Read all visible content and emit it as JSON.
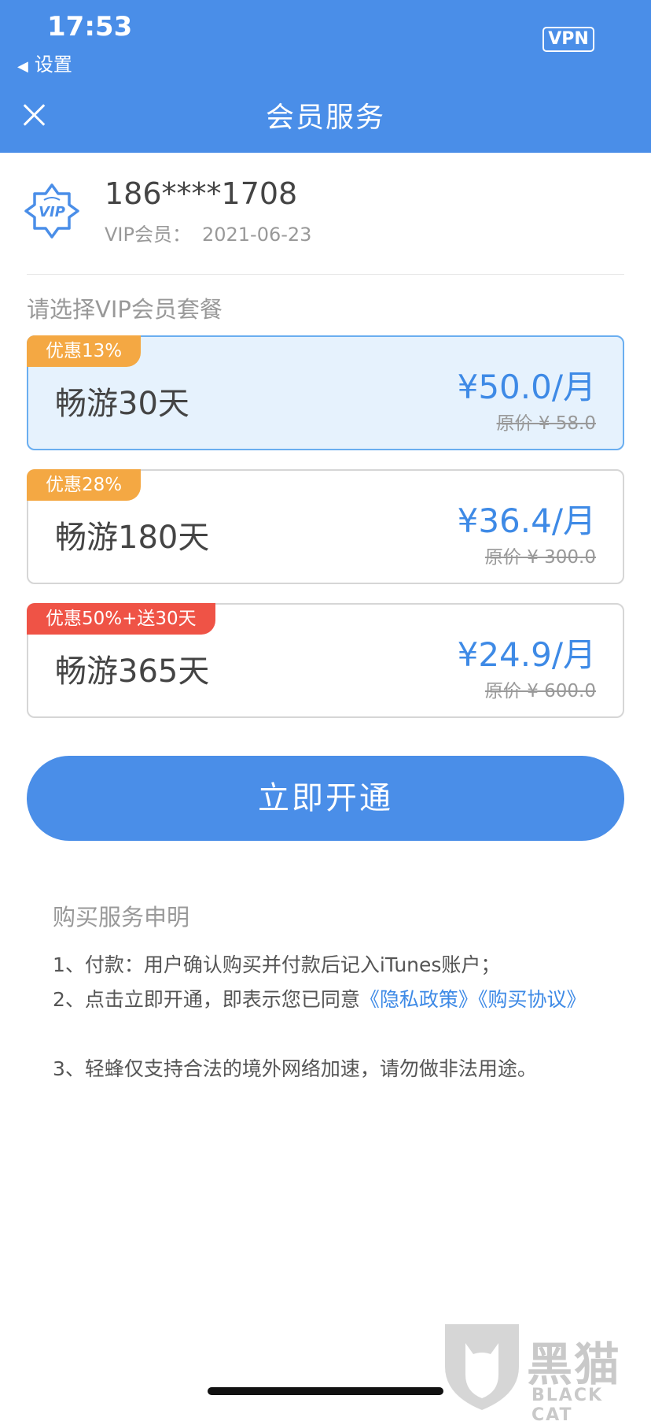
{
  "status_bar": {
    "time": "17:53",
    "back_app": "设置",
    "vpn": "VPN"
  },
  "nav": {
    "title": "会员服务"
  },
  "user": {
    "phone": "186****1708",
    "vip_label": "VIP会员：",
    "vip_date": "2021-06-23"
  },
  "section_title": "请选择VIP会员套餐",
  "plans": [
    {
      "tag": "优惠13%",
      "name": "畅游30天",
      "price": "¥50.0/月",
      "original": "原价 ¥ 58.0",
      "selected": true
    },
    {
      "tag": "优惠28%",
      "name": "畅游180天",
      "price": "¥36.4/月",
      "original": "原价 ¥ 300.0",
      "selected": false
    },
    {
      "tag": "优惠50%+送30天",
      "name": "畅游365天",
      "price": "¥24.9/月",
      "original": "原价 ¥ 600.0",
      "selected": false
    }
  ],
  "cta_label": "立即开通",
  "statement": {
    "title": "购买服务申明",
    "item1": "1、付款：用户确认购买并付款后记入iTunes账户；",
    "item2_prefix": "2、点击立即开通，即表示您已同意",
    "privacy_link": "《隐私政策》",
    "purchase_link": "《购买协议》",
    "item3": "3、轻蜂仅支持合法的境外网络加速，请勿做非法用途。"
  },
  "watermark": {
    "text": "黑猫",
    "sub": "BLACK CAT"
  },
  "colors": {
    "primary": "#4a8ee8",
    "price": "#3e8ae6",
    "tag_orange": "#f4a843",
    "tag_red": "#ef5346",
    "selected_bg": "#e6f2fd"
  }
}
